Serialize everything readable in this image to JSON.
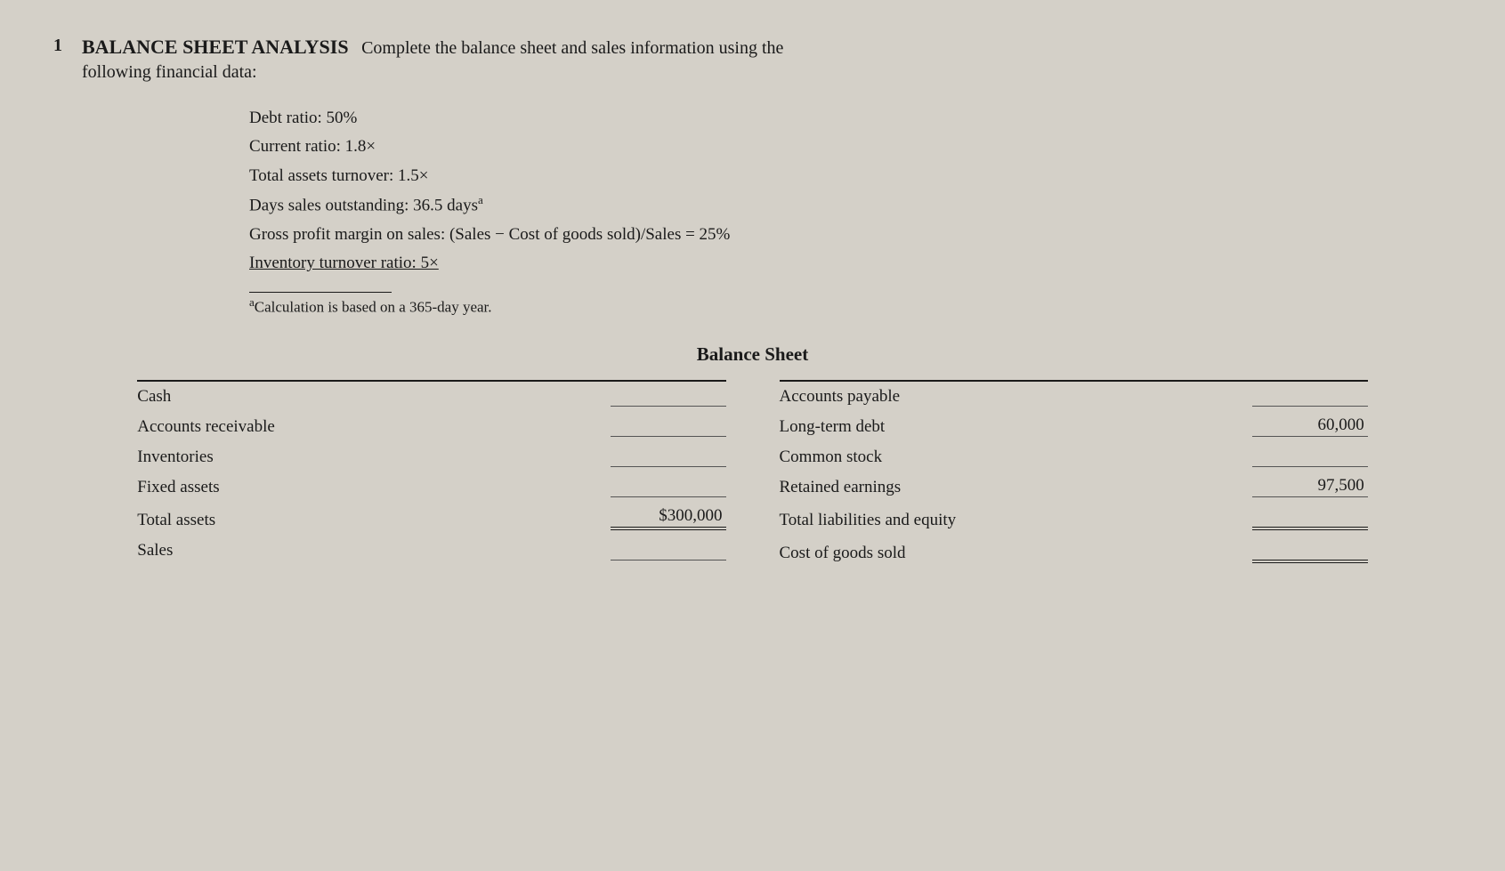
{
  "problem": {
    "number": "1",
    "title": "BALANCE SHEET ANALYSIS",
    "description": "Complete the balance sheet and sales information using the",
    "second_line": "following financial data:",
    "financial_data": [
      "Debt ratio: 50%",
      "Current ratio: 1.8×",
      "Total assets turnover: 1.5×",
      "Days sales outstanding: 36.5 days",
      "Gross profit margin on sales: (Sales − Cost of goods sold)/Sales = 25%",
      "Inventory turnover ratio: 5×"
    ],
    "days_superscript": "a",
    "inventory_underline": true,
    "footnote": "Calculation is based on a 365-day year.",
    "footnote_superscript": "a"
  },
  "balance_sheet": {
    "title": "Balance Sheet",
    "left_items": [
      {
        "label": "Cash",
        "value": "——————"
      },
      {
        "label": "Accounts receivable",
        "value": "——————"
      },
      {
        "label": "Inventories",
        "value": "——————"
      },
      {
        "label": "Fixed assets",
        "value": "——————"
      },
      {
        "label": "Total assets",
        "value": "$300,000"
      },
      {
        "label": "Sales",
        "value": "——————"
      }
    ],
    "right_items": [
      {
        "label": "Accounts payable",
        "value": "——————"
      },
      {
        "label": "Long-term debt",
        "value": "60,000"
      },
      {
        "label": "Common stock",
        "value": "——————"
      },
      {
        "label": "Retained earnings",
        "value": "97,500"
      },
      {
        "label": "Total liabilities and equity",
        "value": "——————"
      },
      {
        "label": "Cost of goods sold",
        "value": "——————"
      }
    ]
  }
}
